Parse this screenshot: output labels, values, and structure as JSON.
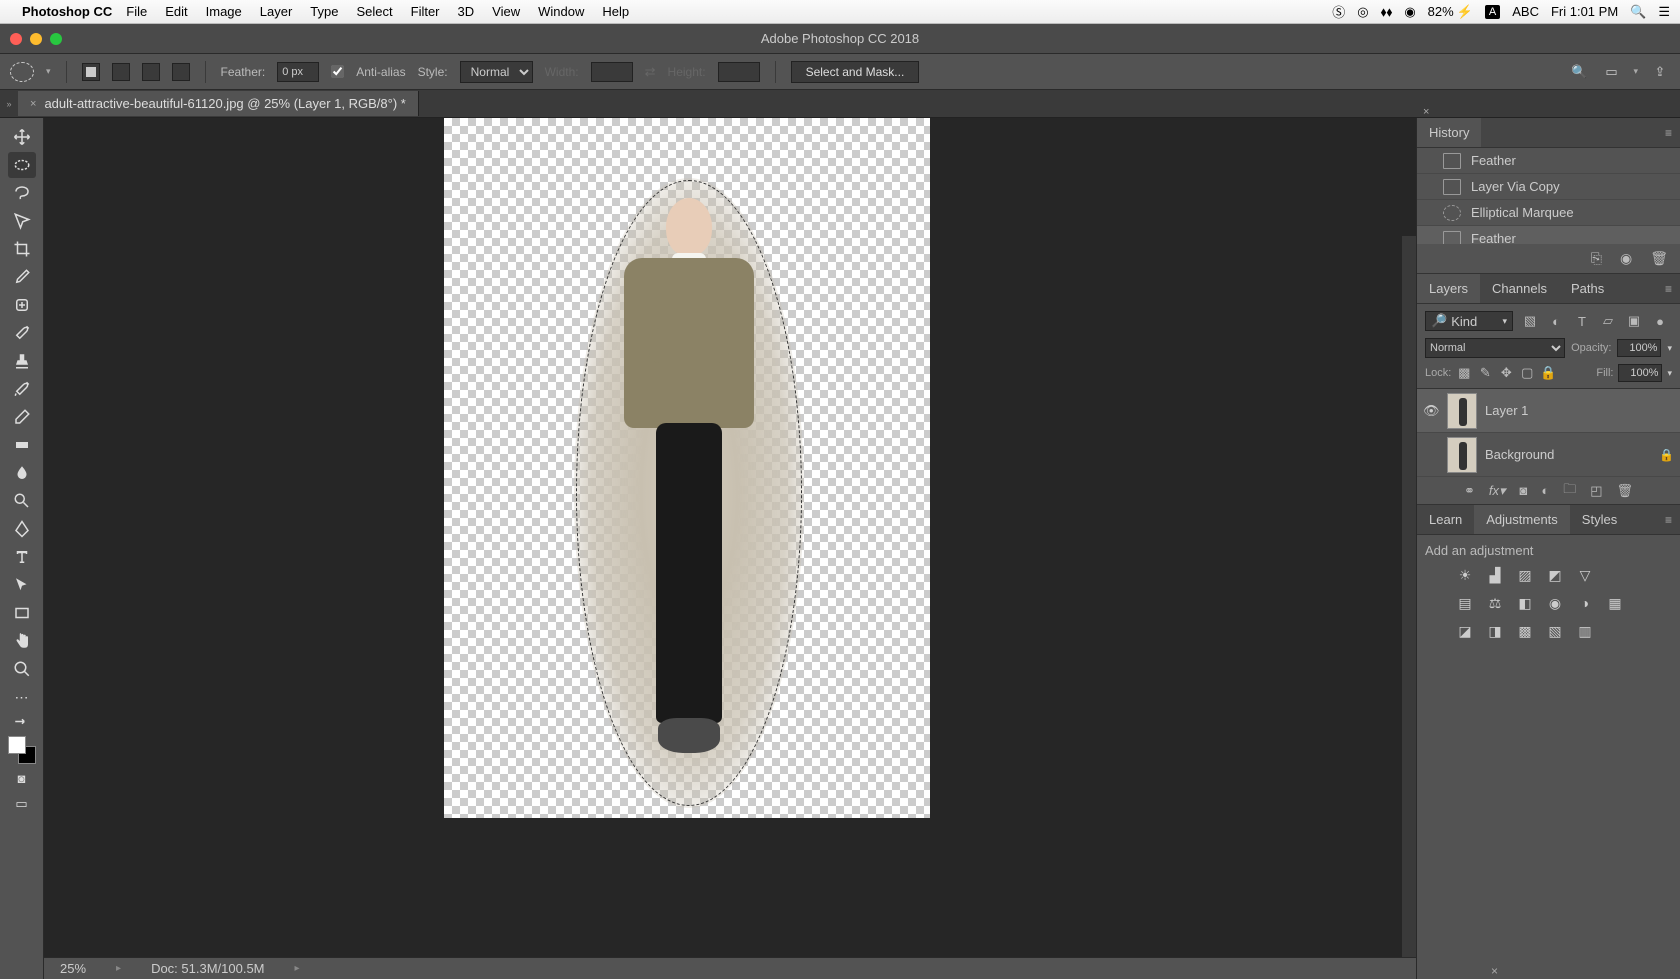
{
  "menubar": {
    "app": "Photoshop CC",
    "items": [
      "File",
      "Edit",
      "Image",
      "Layer",
      "Type",
      "Select",
      "Filter",
      "3D",
      "View",
      "Window",
      "Help"
    ],
    "battery": "82%",
    "input": "ABC",
    "clock": "Fri 1:01 PM"
  },
  "titlebar": {
    "title": "Adobe Photoshop CC 2018"
  },
  "optbar": {
    "feather_label": "Feather:",
    "feather_value": "0 px",
    "antialias": "Anti-alias",
    "style_label": "Style:",
    "style_value": "Normal",
    "width_label": "Width:",
    "height_label": "Height:",
    "select_mask": "Select and Mask..."
  },
  "doctab": {
    "name": "adult-attractive-beautiful-61120.jpg @ 25% (Layer 1, RGB/8°) *"
  },
  "status": {
    "zoom": "25%",
    "doc": "Doc: 51.3M/100.5M"
  },
  "history": {
    "title": "History",
    "items": [
      {
        "label": "Feather",
        "icon": "rect"
      },
      {
        "label": "Layer Via Copy",
        "icon": "rect"
      },
      {
        "label": "Elliptical Marquee",
        "icon": "ellipse"
      },
      {
        "label": "Feather",
        "icon": "rect",
        "selected": true
      }
    ]
  },
  "layers": {
    "tabs": [
      "Layers",
      "Channels",
      "Paths"
    ],
    "kind": "Kind",
    "blend": "Normal",
    "opacity_label": "Opacity:",
    "opacity": "100%",
    "lock_label": "Lock:",
    "fill_label": "Fill:",
    "fill": "100%",
    "items": [
      {
        "name": "Layer 1",
        "visible": true,
        "selected": true,
        "locked": false
      },
      {
        "name": "Background",
        "visible": false,
        "selected": false,
        "locked": true
      }
    ]
  },
  "adjust": {
    "tabs": [
      "Learn",
      "Adjustments",
      "Styles"
    ],
    "label": "Add an adjustment"
  }
}
